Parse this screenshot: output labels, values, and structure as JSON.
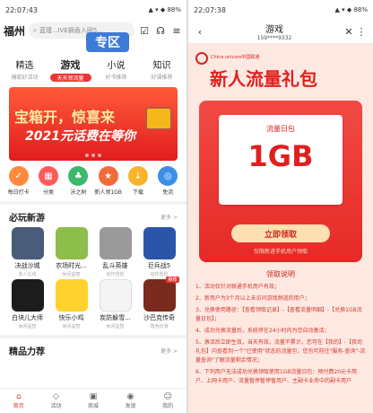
{
  "left": {
    "status": {
      "time": "22:07:43",
      "battery": "88%"
    },
    "city": "福州",
    "search_placeholder": "蓝瑾...IVE摘香入网5...",
    "zone_banner": "专区",
    "tabs": [
      {
        "label": "精选",
        "sub": "爆款好活动",
        "active": false
      },
      {
        "label": "游戏",
        "sub": "天天领流量",
        "active": true
      },
      {
        "label": "小说",
        "sub": "好书推荐",
        "active": false
      },
      {
        "label": "知识",
        "sub": "好课推荐",
        "active": false
      }
    ],
    "promo": {
      "line1": "宝箱开，惊喜来",
      "line2": "2021元话费在等你"
    },
    "quick": [
      {
        "label": "每日打卡",
        "color": "#ff8a3d",
        "icon": "✓"
      },
      {
        "label": "分类",
        "color": "#ff5a5a",
        "icon": "▦"
      },
      {
        "label": "沃之树",
        "color": "#3cb96a",
        "icon": "♣"
      },
      {
        "label": "新人领1GB",
        "color": "#f26b3a",
        "icon": "★"
      },
      {
        "label": "下载",
        "color": "#f7b52c",
        "icon": "↓"
      },
      {
        "label": "免流",
        "color": "#3b8fe6",
        "icon": "◎"
      }
    ],
    "section1": {
      "title": "必玩新游",
      "more": "更多 >"
    },
    "games": [
      {
        "name": "决战沙城",
        "cat": "多人在线",
        "color": "#4a5c7a",
        "badge": ""
      },
      {
        "name": "农场时光...",
        "cat": "休闲益智",
        "color": "#8dbd4a",
        "badge": ""
      },
      {
        "name": "乱斗英雄",
        "cat": "动作冒险",
        "color": "#9a9a9a",
        "badge": ""
      },
      {
        "name": "巨兵战5",
        "cat": "动作冒险",
        "color": "#2b55a8",
        "badge": ""
      },
      {
        "name": "白块儿大师",
        "cat": "休闲益智",
        "color": "#1c1c1c",
        "badge": ""
      },
      {
        "name": "快乐小鸡",
        "cat": "休闲益智",
        "color": "#ffd22e",
        "badge": ""
      },
      {
        "name": "炭防躲雪...",
        "cat": "休闲益智",
        "color": "#f4f4f4",
        "badge": ""
      },
      {
        "name": "沙巴克传奇",
        "cat": "角色扮演",
        "color": "#7a2b1e",
        "badge": "推荐"
      }
    ],
    "section2": {
      "title": "精品力荐",
      "more": "更多 >"
    },
    "nav": [
      {
        "label": "首页",
        "icon": "⌂",
        "active": true
      },
      {
        "label": "活动",
        "icon": "◇",
        "active": false
      },
      {
        "label": "商城",
        "icon": "▣",
        "active": false
      },
      {
        "label": "发现",
        "icon": "◉",
        "active": false
      },
      {
        "label": "我的",
        "icon": "☺",
        "active": false
      }
    ]
  },
  "right": {
    "status": {
      "time": "22:07:38",
      "battery": "88%"
    },
    "header_title": "游戏",
    "header_sub": "159****9332",
    "logo_text": "China unicom中国联通",
    "big_title": "新人流量礼包",
    "card_label": "流量日包",
    "card_value": "1GB",
    "claim_button": "立即领取",
    "hint": "仅限新进手机用户领取",
    "rules_title": "领取说明",
    "rules": [
      "1、活动仅针对联通手机用户有效；",
      "2、新用户为3个月以上未访问游戏频道的用户；",
      "3、兑换使用路径：【查看领取记录】-【查看流量明细】-【兑换1GB流量日包】；",
      "4、成功兑换流量后，系统将在24小时内为您自动激活；",
      "5、激活后立即生效，当天有效，流量不累计。您可在【我的】-【我司礼包】内查看到一个\"已使用\"状态的流量包，您也可前往\"服务-查询\"-流量查询\"了解流量剩余情况；",
      "6、下列用户无法成功兑换领取使用1GB流量日包：预付费20元卡用户、上网卡用户、流量暂停暂停暂用户、主副卡业务中的副卡用户"
    ]
  }
}
